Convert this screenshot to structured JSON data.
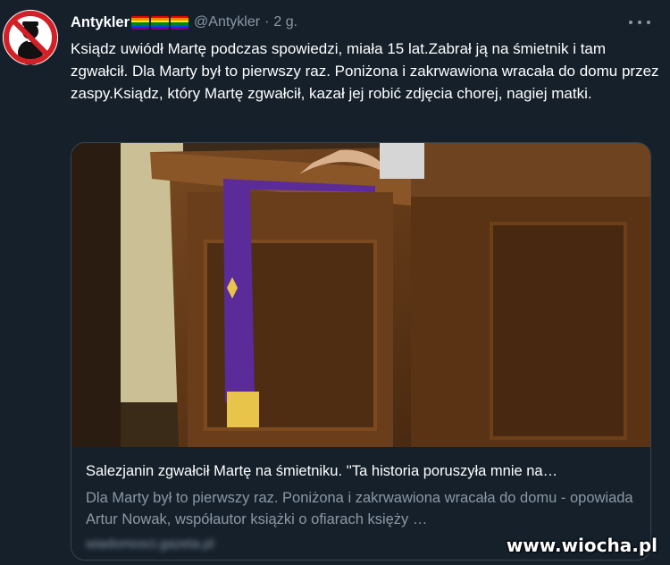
{
  "author": {
    "display_name": "Antykler",
    "handle": "@Antykler",
    "separator": "·",
    "time": "2 g.",
    "avatar_icon": "no-priest-icon",
    "flag_icon": "rainbow-flag-icon"
  },
  "tweet": {
    "text": "Ksiądz uwiódł Martę podczas spowiedzi, miała 15 lat.Zabrał ją na śmietnik i tam zgwałcił. Dla Marty był to pierwszy raz. Poniżona i zakrwawiona wracała do domu przez zaspy.Ksiądz, który Martę zgwałcił, kazał jej robić zdjęcia chorej, nagiej matki."
  },
  "card": {
    "title": "Salezjanin zgwałcił Martę na śmietniku. ''Ta historia poruszyła mnie na…",
    "description": "Dla Marty był to pierwszy raz. Poniżona i zakrwawiona wracała do domu - opowiada Artur Nowak, współautor książki o ofiarach księży …",
    "domain": "wiadomosci.gazeta.pl",
    "image_alt": "confessional-photo"
  },
  "watermark": "www.wiocha.pl",
  "colors": {
    "background": "#15202b",
    "border": "#38444d",
    "secondary_text": "#8b98a5",
    "stole": "#5b2b9a"
  },
  "icons": [
    "more-options-icon"
  ]
}
